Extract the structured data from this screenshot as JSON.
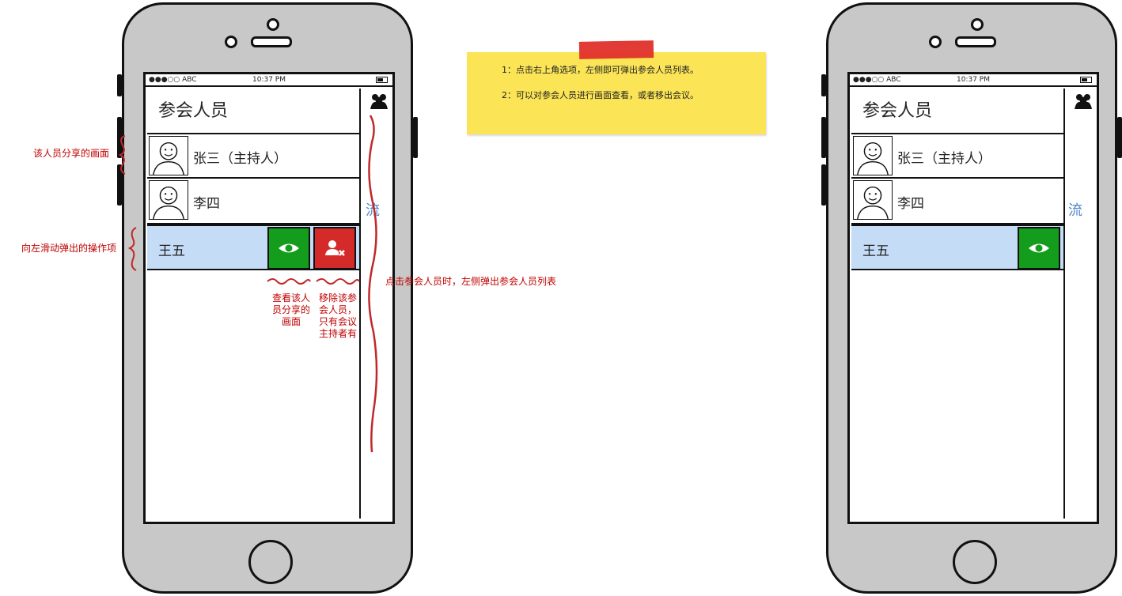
{
  "sticky_note": {
    "line1": "1：点击右上角选项，左侧即可弹出参会人员列表。",
    "line2": "2：可以对参会人员进行画面查看，或者移出会议。"
  },
  "annotations": {
    "shared_screen": "该人员分享的画面",
    "swipe_actions": "向左滑动弹出的操作项",
    "view_button_desc": [
      "查看该人",
      "员分享的",
      "画面"
    ],
    "remove_button_desc": [
      "移除该参",
      "会人员，",
      "只有会议",
      "主持者有"
    ],
    "participants_click": "点击参会人员时，左侧弹出参会人员列表"
  },
  "phone_left": {
    "status": {
      "carrier": "●●●○○ ABC",
      "time": "10:37 PM"
    },
    "panel_title": "参会人员",
    "participants": [
      {
        "name": "张三（主持人）",
        "has_avatar": true,
        "selected": false
      },
      {
        "name": "李四",
        "has_avatar": true,
        "selected": false
      },
      {
        "name": "王五",
        "has_avatar": false,
        "selected": true
      }
    ],
    "background_text": "流",
    "actions": {
      "view_icon": "eye-icon",
      "remove_icon": "remove-user-icon"
    }
  },
  "phone_right": {
    "status": {
      "carrier": "●●●○○ ABC",
      "time": "10:37 PM"
    },
    "panel_title": "参会人员",
    "participants": [
      {
        "name": "张三（主持人）",
        "has_avatar": true,
        "selected": false
      },
      {
        "name": "李四",
        "has_avatar": true,
        "selected": false
      },
      {
        "name": "王五",
        "has_avatar": false,
        "selected": true
      }
    ],
    "background_text": "流",
    "actions": {
      "view_icon": "eye-icon"
    }
  },
  "colors": {
    "selected_row": "#c5dcf7",
    "view_button": "#149c1c",
    "remove_button": "#d42a2a",
    "annotation": "#c00000",
    "sticky": "#fbe456",
    "tape": "#e0302a"
  }
}
